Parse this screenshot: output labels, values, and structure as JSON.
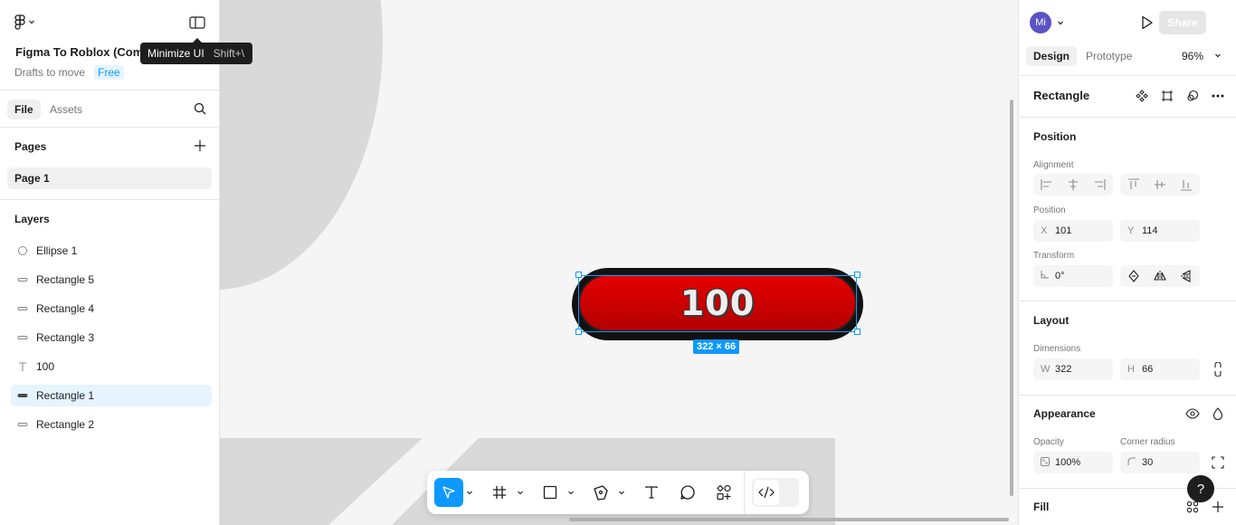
{
  "left_panel": {
    "file_title": "Figma To Roblox (Community)",
    "location": "Drafts to move",
    "plan_badge": "Free",
    "tooltip": {
      "label": "Minimize UI",
      "shortcut": "Shift+\\"
    },
    "tabs": [
      {
        "label": "File",
        "active": true
      },
      {
        "label": "Assets",
        "active": false
      }
    ],
    "pages_title": "Pages",
    "pages": [
      {
        "label": "Page 1",
        "selected": true
      }
    ],
    "layers_title": "Layers",
    "layers": [
      {
        "label": "Ellipse 1",
        "icon": "ellipse-icon",
        "selected": false
      },
      {
        "label": "Rectangle 5",
        "icon": "rectangle-icon",
        "selected": false
      },
      {
        "label": "Rectangle 4",
        "icon": "rectangle-icon",
        "selected": false
      },
      {
        "label": "Rectangle 3",
        "icon": "rectangle-icon",
        "selected": false
      },
      {
        "label": "100",
        "icon": "text-icon",
        "selected": false
      },
      {
        "label": "Rectangle 1",
        "icon": "rectangle-icon",
        "selected": true
      },
      {
        "label": "Rectangle 2",
        "icon": "rectangle-icon",
        "selected": false
      }
    ]
  },
  "canvas": {
    "button_text": "100",
    "selection_size": "322 × 66",
    "accent": "#0d99ff"
  },
  "right_panel": {
    "avatar_initials": "Mi",
    "share_label": "Share",
    "tabs": [
      {
        "label": "Design",
        "active": true
      },
      {
        "label": "Prototype",
        "active": false
      }
    ],
    "zoom": "96%",
    "layer_name": "Rectangle",
    "position_title": "Position",
    "alignment_label": "Alignment",
    "position_label": "Position",
    "x_prefix": "X",
    "x_value": "101",
    "y_prefix": "Y",
    "y_value": "114",
    "transform_label": "Transform",
    "rotation_value": "0°",
    "layout_title": "Layout",
    "dimensions_label": "Dimensions",
    "w_prefix": "W",
    "w_value": "322",
    "h_prefix": "H",
    "h_value": "66",
    "appearance_title": "Appearance",
    "opacity_label": "Opacity",
    "opacity_value": "100%",
    "corner_radius_label": "Corner radius",
    "corner_radius_value": "30",
    "fill_title": "Fill",
    "help_label": "?"
  }
}
